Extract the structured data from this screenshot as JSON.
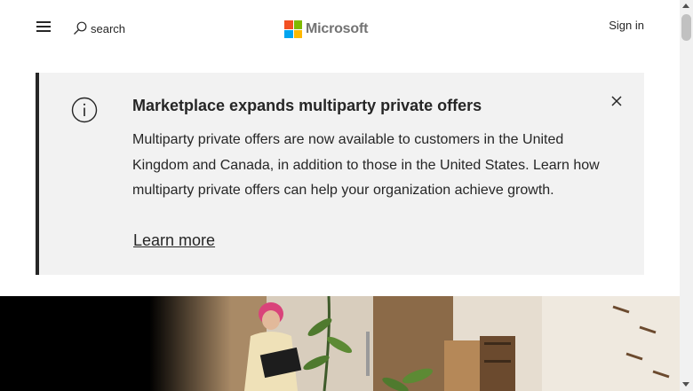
{
  "header": {
    "menu_icon": "hamburger-menu-icon",
    "search_icon": "search-icon",
    "search_label": "search",
    "logo_text": "Microsoft",
    "logo_colors": [
      "#f25022",
      "#7fba00",
      "#00a4ef",
      "#ffb900"
    ],
    "signin_label": "Sign in"
  },
  "alert": {
    "icon": "info-icon",
    "title": "Marketplace expands multiparty private offers",
    "body": "Multiparty private offers are now available to customers in the United Kingdom and Canada, in addition to those in the United States. Learn how multiparty private offers can help your organization achieve growth.",
    "link_label": "Learn more",
    "close_icon": "close-icon"
  },
  "hero": {
    "image": "photo of a person with pink hair using a laptop in a room with plants and shelves"
  },
  "colors": {
    "text": "#262626",
    "alert_background": "#f2f2f2",
    "alert_border": "#262626",
    "logo_gray": "#737373"
  }
}
